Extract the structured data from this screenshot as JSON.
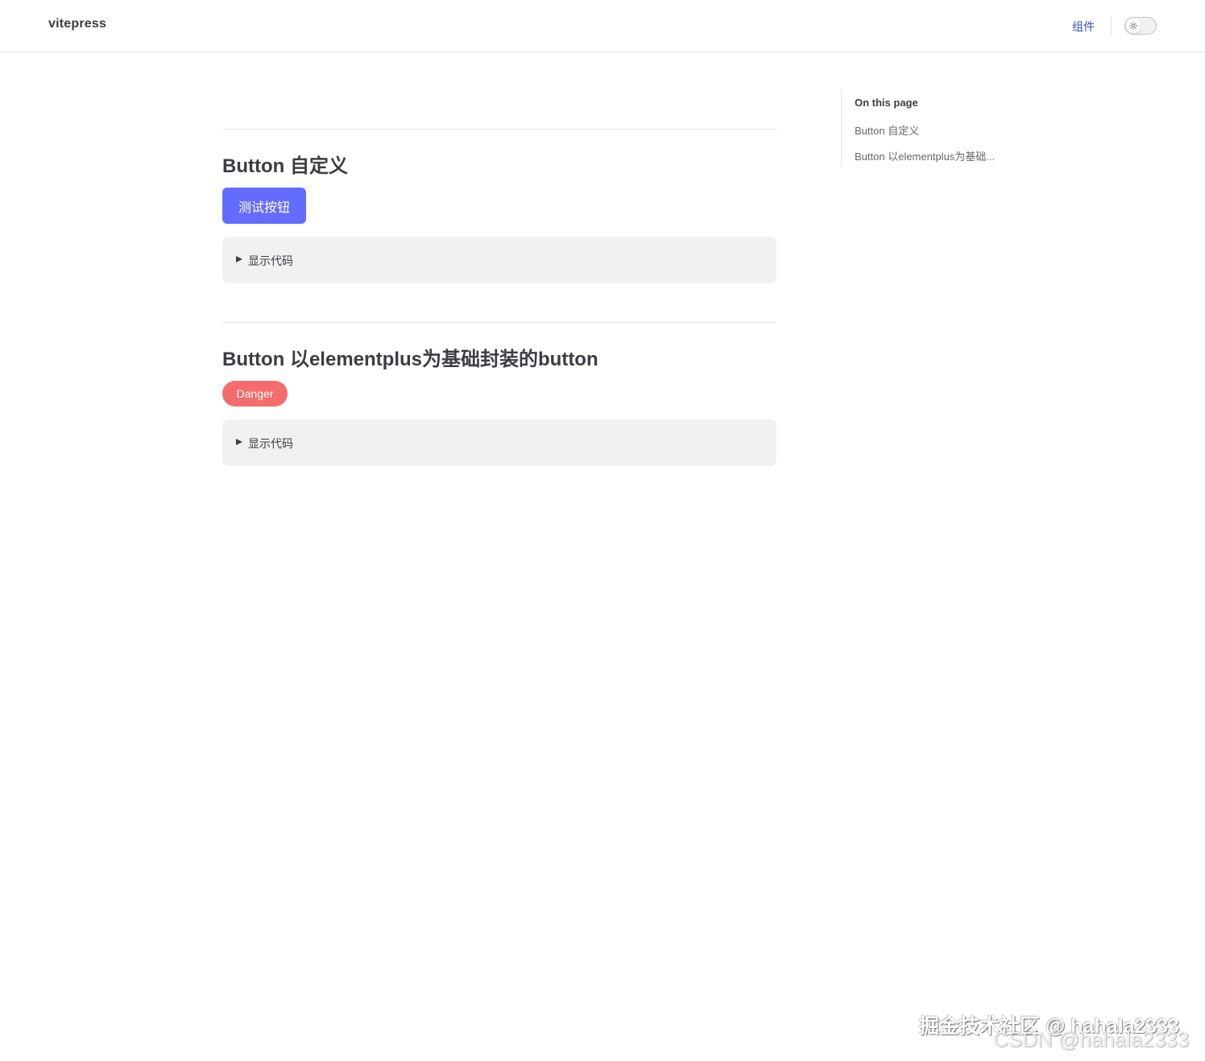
{
  "header": {
    "site_title": "vitepress",
    "nav_link": "组件",
    "theme_toggle_icon": "sun-icon"
  },
  "sections": [
    {
      "heading": "Button 自定义",
      "demo_button_label": "测试按钮",
      "demo_button_color": "#646cff",
      "details_label": "显示代码"
    },
    {
      "heading": "Button 以elementplus为基础封装的button",
      "demo_button_label": "Danger",
      "demo_button_color": "#f56c6c",
      "details_label": "显示代码"
    }
  ],
  "outline": {
    "title": "On this page",
    "links": [
      "Button 自定义",
      "Button 以elementplus为基础..."
    ]
  },
  "watermark": {
    "line1": "掘金技术社区 @ hahala2333",
    "line2": "CSDN @hahala2333"
  },
  "colors": {
    "brand": "#646cff",
    "danger": "#f56c6c",
    "nav_link": "#3451b2"
  }
}
